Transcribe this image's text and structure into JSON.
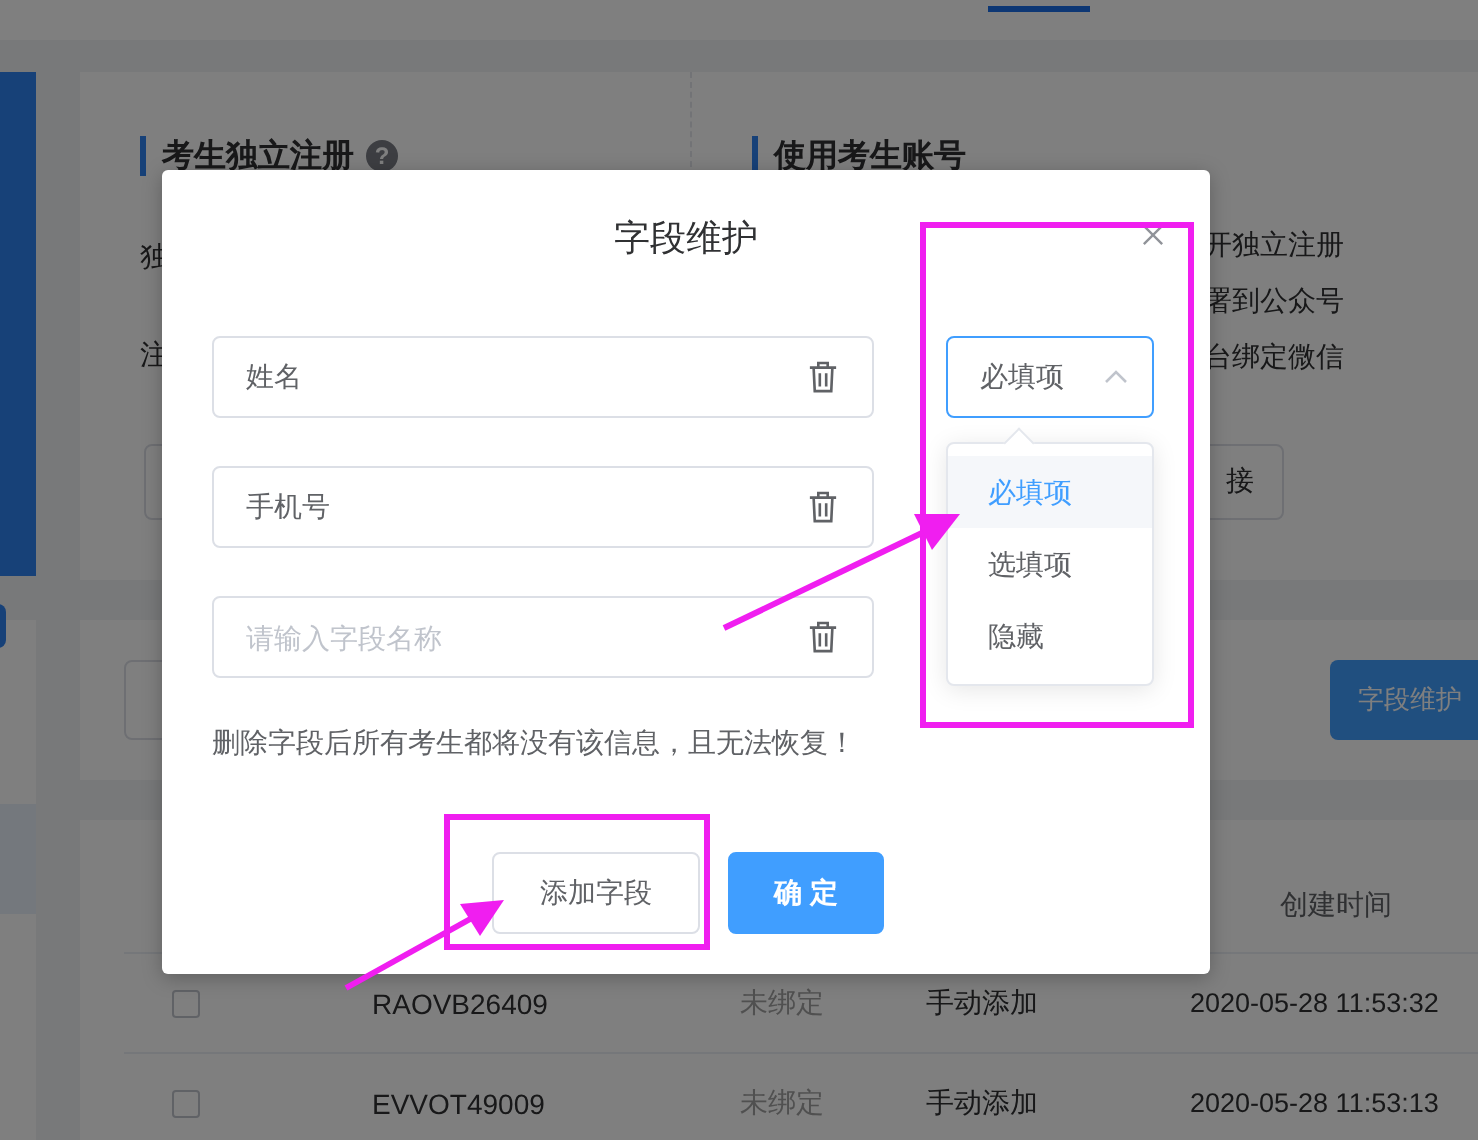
{
  "page": {
    "sections": [
      {
        "title": "考生独立注册",
        "help": "?"
      },
      {
        "title": "使用考生账号"
      }
    ],
    "left_fragments": [
      "独",
      "注"
    ],
    "right_lines": [
      "开独立注册",
      "署到公众号",
      "台绑定微信"
    ],
    "link_button": "接",
    "field_button": "字段维护",
    "table": {
      "columns": [
        "创建时间"
      ],
      "rows": [
        {
          "checked": false,
          "code": "RAOVB26409",
          "bind_status": "未绑定",
          "source": "手动添加",
          "created": "2020-05-28 11:53:32"
        },
        {
          "checked": false,
          "code": "EVVOT49009",
          "bind_status": "未绑定",
          "source": "手动添加",
          "created": "2020-05-28 11:53:13"
        }
      ]
    }
  },
  "dialog": {
    "title": "字段维护",
    "fields": [
      {
        "value": "姓名"
      },
      {
        "value": "手机号"
      },
      {
        "placeholder": "请输入字段名称"
      }
    ],
    "requirement_select": {
      "value": "必填项",
      "expanded": true,
      "options": [
        {
          "label": "必填项",
          "selected": true
        },
        {
          "label": "选填项",
          "selected": false
        },
        {
          "label": "隐藏",
          "selected": false
        }
      ]
    },
    "warning": "删除字段后所有考生都将没有该信息，且无法恢复！",
    "buttons": [
      {
        "label": "添加字段",
        "kind": "secondary"
      },
      {
        "label": "确 定",
        "kind": "primary"
      }
    ]
  }
}
